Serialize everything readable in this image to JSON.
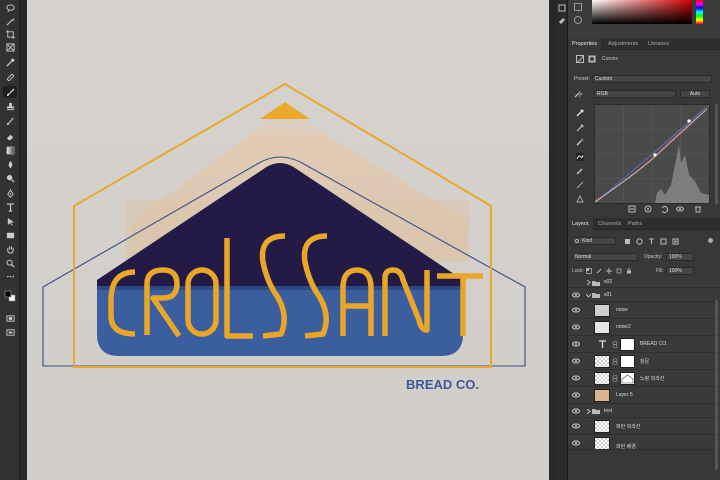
{
  "toolbar": {
    "tools": [
      "lasso-icon",
      "magic-wand-icon",
      "crop-icon",
      "frame-icon",
      "eyedropper-icon",
      "healing-brush-icon",
      "brush-icon",
      "clone-stamp-icon",
      "history-brush-icon",
      "eraser-icon",
      "gradient-icon",
      "blur-icon",
      "dodge-icon",
      "pen-icon",
      "type-icon",
      "path-select-icon",
      "rectangle-icon",
      "hand-icon",
      "zoom-icon",
      "more-tools-icon",
      "color-swatches-icon",
      "quick-mask-icon",
      "screen-mode-icon"
    ]
  },
  "canvas": {
    "title_word": "CROISSANT",
    "subtitle": "BREAD CO.",
    "colors": {
      "paper": "#d5d1cd",
      "navy": "#241b46",
      "blue": "#3a5d9c",
      "gold": "#e8a623",
      "outline": "#2f3f78"
    }
  },
  "panels": {
    "properties_tabs": [
      "Properties",
      "Adjustments",
      "Libraries"
    ],
    "adjustment_name": "Curves",
    "preset_label": "Preset:",
    "preset_value": "Custom",
    "channel_value": "RGB",
    "auto_label": "Auto"
  },
  "layers_panel": {
    "tabs": [
      "Layers",
      "Channels",
      "Paths"
    ],
    "filter_kind": "Kind",
    "blend_mode": "Normal",
    "opacity_label": "Opacity:",
    "opacity_value": "100%",
    "lock_label": "Lock:",
    "fill_label": "Fill:",
    "fill_value": "100%",
    "layers": [
      {
        "name": "s02",
        "type": "group",
        "collapsed": true
      },
      {
        "name": "s01",
        "type": "group",
        "collapsed": false
      },
      {
        "name": "noise",
        "type": "pixel"
      },
      {
        "name": "noise2",
        "type": "pixel"
      },
      {
        "name": "BREAD CO.",
        "type": "text"
      },
      {
        "name": "창문",
        "type": "shape"
      },
      {
        "name": "노랑 외곽선",
        "type": "shape"
      },
      {
        "name": "Layer 5",
        "type": "pixel"
      },
      {
        "name": "text",
        "type": "group",
        "collapsed": true
      },
      {
        "name": "파란 외곽선",
        "type": "shape"
      },
      {
        "name": "파란 배경",
        "type": "shape"
      }
    ]
  }
}
